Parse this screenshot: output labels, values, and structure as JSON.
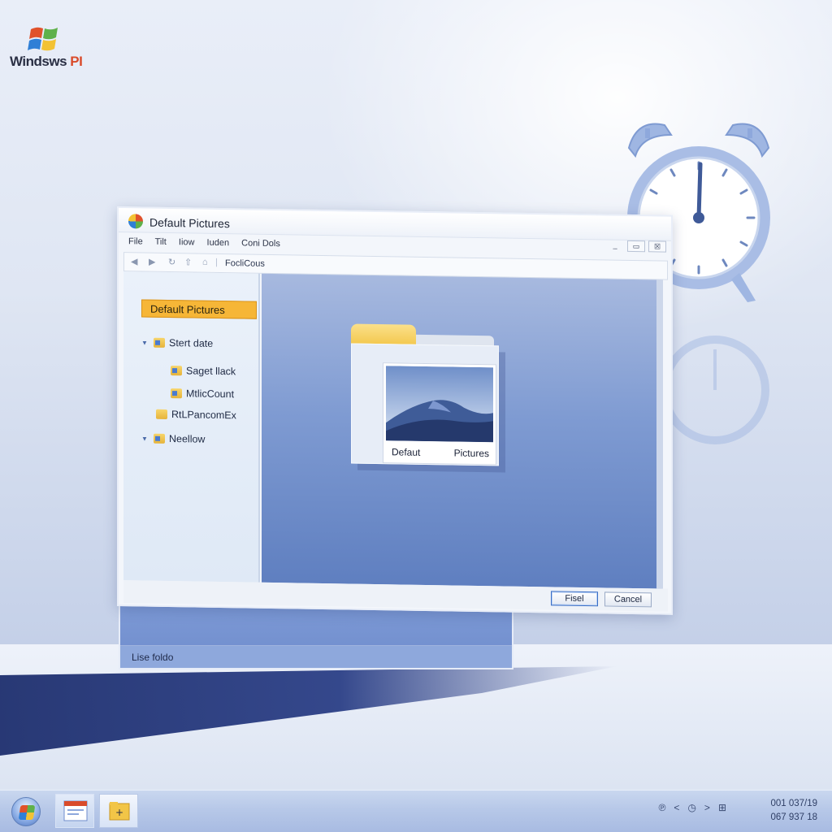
{
  "logo": {
    "brand": "Windsws",
    "suffix": "PI"
  },
  "dialog": {
    "title": "Default Pictures",
    "menu": [
      "File",
      "Tilt",
      "Iiow",
      "Iuden",
      "Coni Dols"
    ],
    "window_controls": [
      "_",
      "▭",
      "☒"
    ],
    "toolbar_label": "FocliCous",
    "sidebar": {
      "selected": "Default Pictures",
      "items": [
        {
          "label": "Stert date",
          "expand": "▼"
        },
        {
          "label": "Saget llack"
        },
        {
          "label": "MtlicCount"
        },
        {
          "label": "RtLPancomEx"
        },
        {
          "label": "Neellow",
          "expand": "▼"
        }
      ]
    },
    "preview": {
      "caption_left": "Defaut",
      "caption_right": "Pictures"
    },
    "buttons": {
      "primary": "Fisel",
      "cancel": "Cancel"
    },
    "status": "Lise foldo"
  },
  "taskbar": {
    "tray_symbols": [
      "℗",
      "<",
      "◷",
      ">",
      "⊞"
    ],
    "time_line1": "001 037/19",
    "time_line2": "067 937 18"
  },
  "colors": {
    "selection": "#f6b637",
    "content_top": "#a7b9df",
    "content_bottom": "#5f7fc0",
    "taskbar": "#b7c8e8"
  }
}
